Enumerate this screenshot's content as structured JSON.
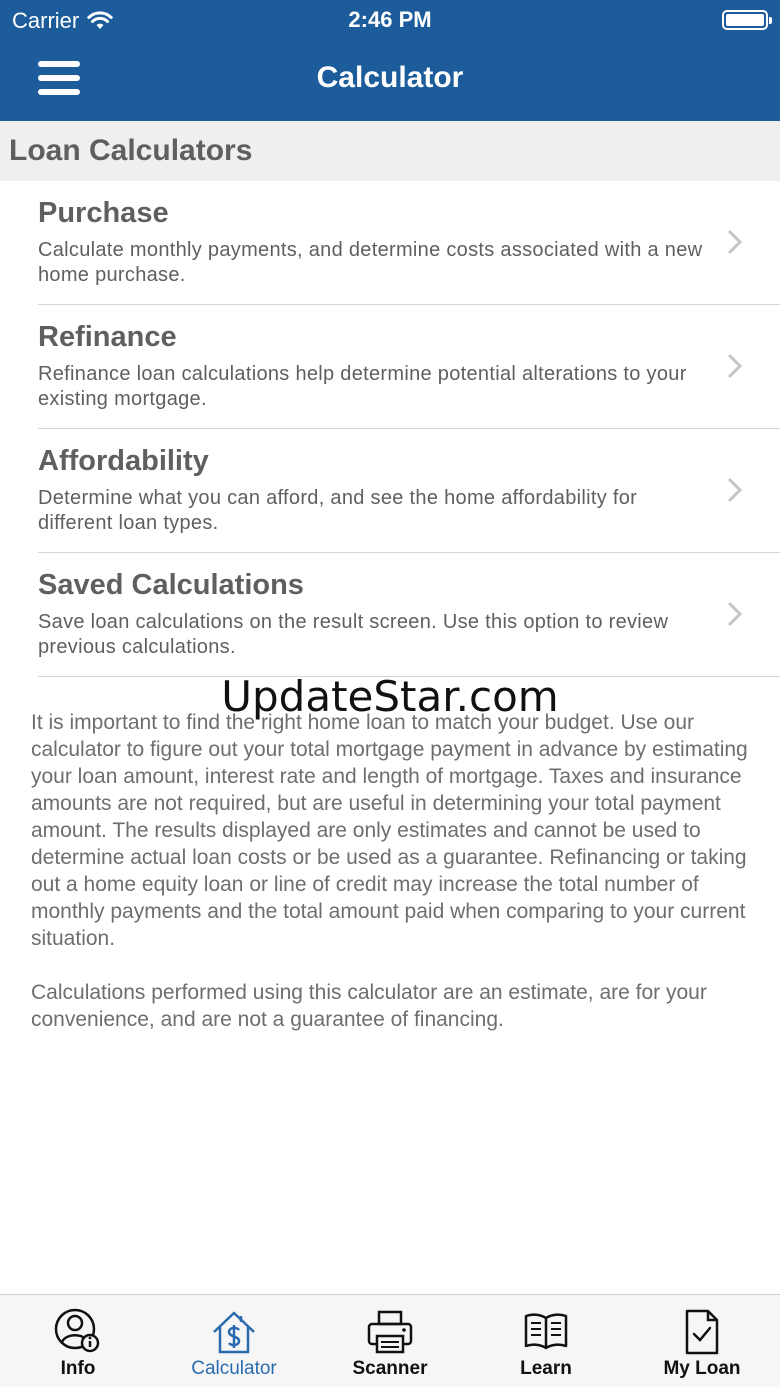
{
  "status_bar": {
    "carrier": "Carrier",
    "time": "2:46 PM"
  },
  "nav": {
    "title": "Calculator"
  },
  "section": {
    "title": "Loan Calculators"
  },
  "items": [
    {
      "title": "Purchase",
      "description": "Calculate monthly payments, and determine costs associated with a new home purchase."
    },
    {
      "title": "Refinance",
      "description": "Refinance loan calculations help determine potential alterations to your existing mortgage."
    },
    {
      "title": "Affordability",
      "description": "Determine what you can afford, and see the home affordability for different loan types."
    },
    {
      "title": "Saved Calculations",
      "description": "Save loan calculations on the result screen. Use this option to review previous calculations."
    }
  ],
  "watermark": "UpdateStar.com",
  "disclaimer": {
    "paragraph1": "It is important to find the right home loan to match your budget. Use our calculator to figure out your total mortgage payment in advance by estimating your loan amount, interest rate and length of mortgage. Taxes and insurance amounts are not required, but are useful in determining your total payment amount.  The results displayed are only estimates and cannot be used to determine actual loan costs or be used as a guarantee. Refinancing or taking out a home equity loan or line of credit may increase the total number of monthly payments and the total amount paid when comparing to your current situation.",
    "paragraph2": "Calculations performed using this calculator are an estimate, are for your convenience, and are not a guarantee of financing."
  },
  "tabs": [
    {
      "label": "Info",
      "icon": "user-info-icon"
    },
    {
      "label": "Calculator",
      "icon": "house-dollar-icon",
      "active": true
    },
    {
      "label": "Scanner",
      "icon": "printer-icon"
    },
    {
      "label": "Learn",
      "icon": "book-icon"
    },
    {
      "label": "My Loan",
      "icon": "document-check-icon"
    }
  ],
  "colors": {
    "nav_bar": "#1c5c9b",
    "active_tab": "#2a6bb0",
    "section_bg": "#efefef"
  }
}
